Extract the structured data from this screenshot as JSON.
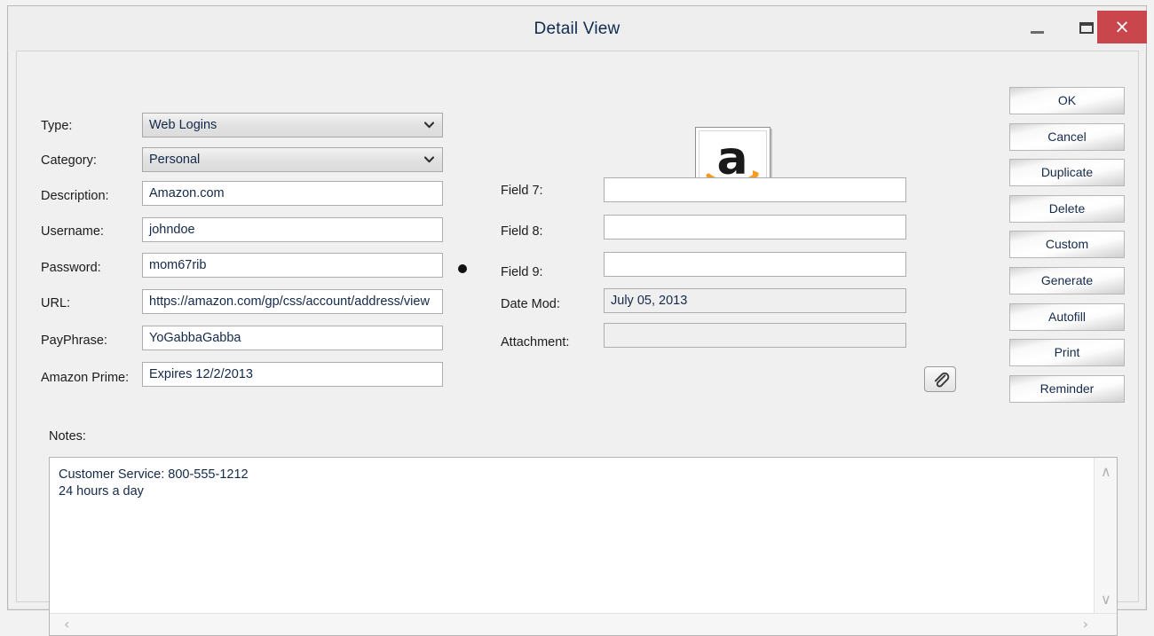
{
  "window": {
    "title": "Detail View",
    "controls": {
      "minimize": "–",
      "maximize": "",
      "close": "×"
    },
    "accent_close_color": "#c9474c"
  },
  "left_fields": [
    {
      "label": "Type:",
      "value": "Web Logins",
      "kind": "combo"
    },
    {
      "label": "Category:",
      "value": "Personal",
      "kind": "combo"
    },
    {
      "label": "Description:",
      "value": "Amazon.com",
      "kind": "text"
    },
    {
      "label": "Username:",
      "value": "johndoe",
      "kind": "text"
    },
    {
      "label": "Password:",
      "value": "mom67rib",
      "kind": "text"
    },
    {
      "label": "URL:",
      "value": "https://amazon.com/gp/css/account/address/view",
      "kind": "text"
    },
    {
      "label": "PayPhrase:",
      "value": "YoGabbaGabba",
      "kind": "text"
    },
    {
      "label": "Amazon Prime:",
      "value": "Expires 12/2/2013",
      "kind": "text"
    }
  ],
  "right_fields": [
    {
      "label": "Field 7:",
      "value": "",
      "kind": "text"
    },
    {
      "label": "Field 8:",
      "value": "",
      "kind": "text"
    },
    {
      "label": "Field 9:",
      "value": "",
      "kind": "text"
    },
    {
      "label": "Date Mod:",
      "value": "July 05, 2013",
      "kind": "readonly"
    },
    {
      "label": "Attachment:",
      "value": "",
      "kind": "readonly"
    }
  ],
  "attachment_button": {
    "icon": "paperclip-icon"
  },
  "logo": {
    "name": "amazon-logo",
    "letter": "a",
    "letter_color": "#1a1a1a",
    "arrow_color": "#f59a23"
  },
  "action_buttons": [
    "OK",
    "Cancel",
    "Duplicate",
    "Delete",
    "Custom",
    "Generate",
    "Autofill",
    "Print",
    "Reminder"
  ],
  "notes": {
    "label": "Notes:",
    "text": "Customer Service: 800-555-1212\n24 hours a day"
  },
  "scrollbars": {
    "up": "∧",
    "down": "∨",
    "left": "‹",
    "right": "›"
  },
  "password_indicator": {
    "name": "password-strength-dot",
    "color": "#111111"
  }
}
